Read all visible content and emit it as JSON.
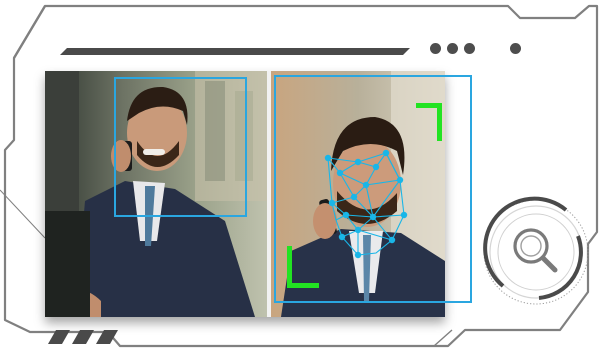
{
  "colors": {
    "frame_stroke": "#7f7f7f",
    "accent_dark": "#4a4a4a",
    "detect_blue": "#2aa6e0",
    "mesh_cyan": "#19b6e8",
    "corner_green": "#22e322"
  },
  "header": {
    "indicator_dots": 4
  },
  "photo": {
    "panels": [
      {
        "name": "original",
        "detection": "face-box"
      },
      {
        "name": "landmarks",
        "detection": "face-mesh"
      }
    ]
  },
  "icons": {
    "scanner": "magnifier-icon",
    "status": "indicator-dot",
    "decor": "stripes-icon"
  }
}
